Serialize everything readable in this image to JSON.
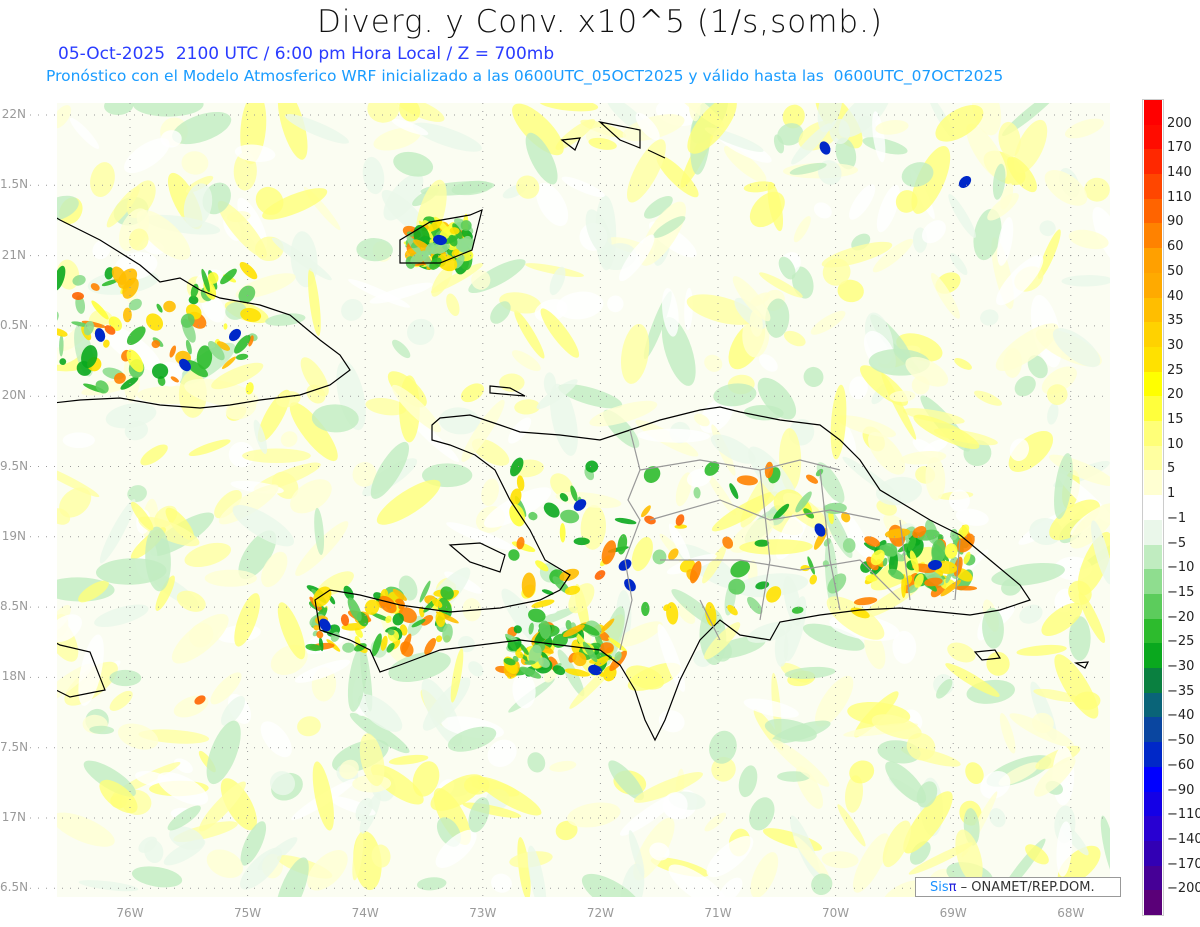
{
  "header": {
    "title": "Diverg. y Conv. x10^5 (1/s,somb.)",
    "subtitle": "05-Oct-2025  2100 UTC / 6:00 pm Hora Local / Z = 700mb",
    "forecast_info": "Pronóstico con el Modelo Atmosferico WRF inicializado a las 0600UTC_05OCT2025 y válido hasta las  0600UTC_07OCT2025"
  },
  "axes": {
    "lat_labels": [
      "22N",
      "1.5N",
      "21N",
      "0.5N",
      "20N",
      "9.5N",
      "19N",
      "8.5N",
      "18N",
      "7.5N",
      "17N",
      "6.5N"
    ],
    "lon_labels": [
      "76W",
      "75W",
      "74W",
      "73W",
      "72W",
      "71W",
      "70W",
      "69W",
      "68W"
    ]
  },
  "colorbar": {
    "labels": [
      "200",
      "170",
      "140",
      "110",
      "90",
      "60",
      "50",
      "40",
      "35",
      "30",
      "25",
      "20",
      "15",
      "10",
      "5",
      "1",
      "−1",
      "−5",
      "−10",
      "−15",
      "−20",
      "−25",
      "−30",
      "−35",
      "−40",
      "−50",
      "−60",
      "−90",
      "−110",
      "−140",
      "−170",
      "−200"
    ],
    "colors": [
      "#ff0000",
      "#ff0c00",
      "#ff2800",
      "#ff4600",
      "#ff6400",
      "#ff8200",
      "#ffa000",
      "#ffaa00",
      "#ffbe00",
      "#ffd200",
      "#ffe100",
      "#ffff00",
      "#ffff3c",
      "#ffff78",
      "#ffffa0",
      "#ffffd2",
      "#ffffff",
      "#eaf7ea",
      "#c0ecc0",
      "#8fdd8f",
      "#5ccc5c",
      "#2dbb2d",
      "#0aa81e",
      "#0a8040",
      "#0a6478",
      "#0a46a0",
      "#0028c8",
      "#0000ff",
      "#1400e6",
      "#2800d2",
      "#3200b4",
      "#460096",
      "#5a0078"
    ]
  },
  "credit": {
    "sis": "Sis",
    "pi": "π",
    "org": " – ONAMET/REP.DOM."
  }
}
